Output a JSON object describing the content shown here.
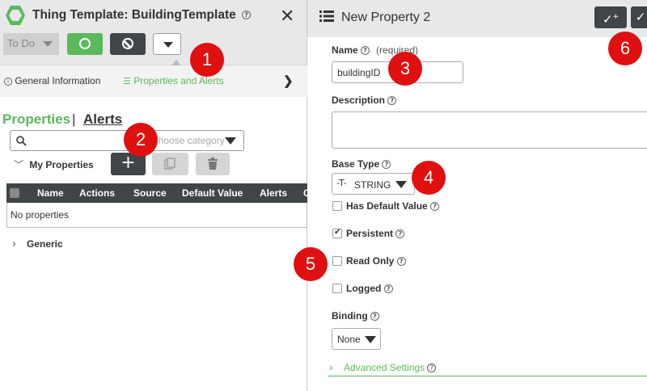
{
  "left": {
    "title": "Thing Template: BuildingTemplate",
    "state": "To Do",
    "tabs": {
      "general": "General Information",
      "properties": "Properties and Alerts"
    },
    "section_links": {
      "properties": "Properties",
      "separator": "|",
      "alerts": "Alerts"
    },
    "category_placeholder": "Choose category",
    "group_my_properties": "My Properties",
    "table": {
      "headers": [
        "Name",
        "Actions",
        "Source",
        "Default Value",
        "Alerts",
        "C"
      ],
      "empty_text": "No properties"
    },
    "group_generic": "Generic"
  },
  "right": {
    "title": "New Property 2",
    "name_label": "Name",
    "required_note": "(required)",
    "name_value": "buildingID",
    "description_label": "Description",
    "base_type_label": "Base Type",
    "base_type_value": "STRING",
    "checkboxes": [
      {
        "label": "Has Default Value",
        "checked": false
      },
      {
        "label": "Persistent",
        "checked": true
      },
      {
        "label": "Read Only",
        "checked": false
      },
      {
        "label": "Logged",
        "checked": false
      }
    ],
    "binding_label": "Binding",
    "binding_value": "None",
    "advanced_settings": "Advanced Settings"
  },
  "callouts": [
    "1",
    "2",
    "3",
    "4",
    "5",
    "6"
  ],
  "colors": {
    "accent_green": "#5cb85c",
    "dark_button": "#3f4548",
    "callout_red": "#e01010"
  },
  "icons": [
    "thing-template-hex-icon",
    "help-icon",
    "close-icon",
    "start-icon",
    "stop-icon",
    "chevron-down-icon",
    "info-icon",
    "list-icon",
    "chevron-right-icon",
    "search-icon",
    "add-icon",
    "copy-icon",
    "delete-icon",
    "hamburger-icon",
    "save-new-icon",
    "save-icon",
    "string-type-icon",
    "checkmark-icon"
  ]
}
